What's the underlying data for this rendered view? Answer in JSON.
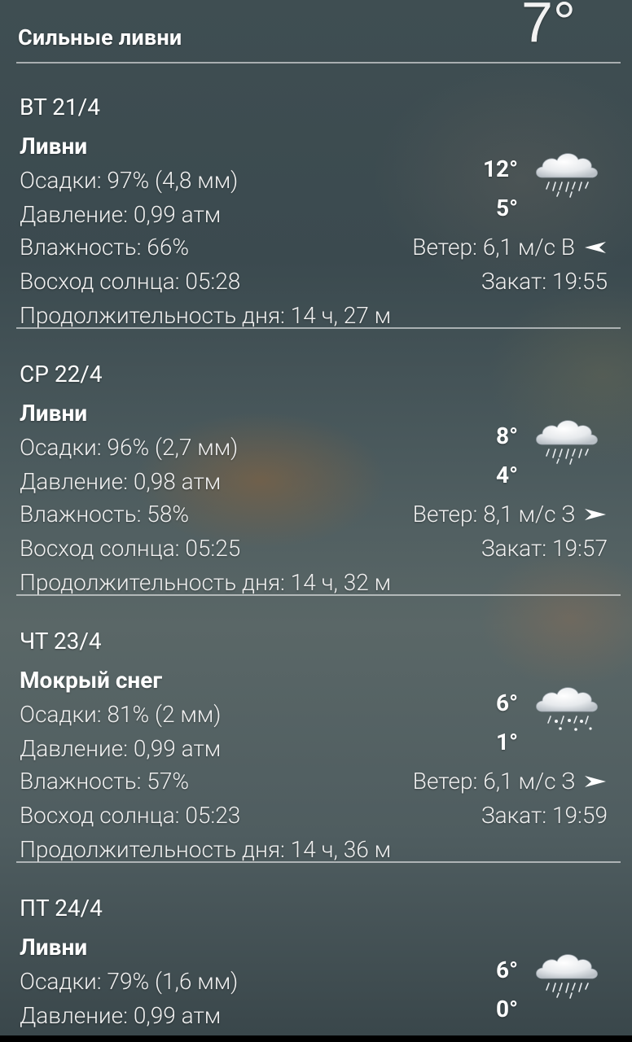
{
  "header": {
    "title": "Сильные ливни",
    "current_temp": "7°"
  },
  "days": [
    {
      "date": "ВТ 21/4",
      "condition": "Ливни",
      "precip": "Осадки: 97% (4,8 мм)",
      "pressure": "Давление: 0,99 атм",
      "humidity": "Влажность: 66%",
      "sunrise": "Восход солнца: 05:28",
      "daylength": "Продолжительность дня: 14 ч, 27 м",
      "temp_max": "12°",
      "temp_min": "5°",
      "wind": "Ветер: 6,1 м/с В",
      "sunset": "Закат: 19:55",
      "icon": "heavy-rain-cloud-icon",
      "wind_icon": "wind-arrow-west-icon"
    },
    {
      "date": "СР 22/4",
      "condition": "Ливни",
      "precip": "Осадки: 96% (2,7 мм)",
      "pressure": "Давление: 0,98 атм",
      "humidity": "Влажность: 58%",
      "sunrise": "Восход солнца: 05:25",
      "daylength": "Продолжительность дня: 14 ч, 32 м",
      "temp_max": "8°",
      "temp_min": "4°",
      "wind": "Ветер: 8,1 м/с З",
      "sunset": "Закат: 19:57",
      "icon": "heavy-rain-cloud-icon",
      "wind_icon": "wind-arrow-east-icon"
    },
    {
      "date": "ЧТ 23/4",
      "condition": "Мокрый снег",
      "precip": "Осадки: 81% (2 мм)",
      "pressure": "Давление: 0,99 атм",
      "humidity": "Влажность: 57%",
      "sunrise": "Восход солнца: 05:23",
      "daylength": "Продолжительность дня: 14 ч, 36 м",
      "temp_max": "6°",
      "temp_min": "1°",
      "wind": "Ветер: 6,1 м/с З",
      "sunset": "Закат: 19:59",
      "icon": "sleet-cloud-icon",
      "wind_icon": "wind-arrow-east-icon"
    },
    {
      "date": "ПТ 24/4",
      "condition": "Ливни",
      "precip": "Осадки: 79% (1,6 мм)",
      "pressure": "Давление: 0,99 атм",
      "temp_max": "6°",
      "temp_min": "0°",
      "icon": "heavy-rain-cloud-icon"
    }
  ]
}
